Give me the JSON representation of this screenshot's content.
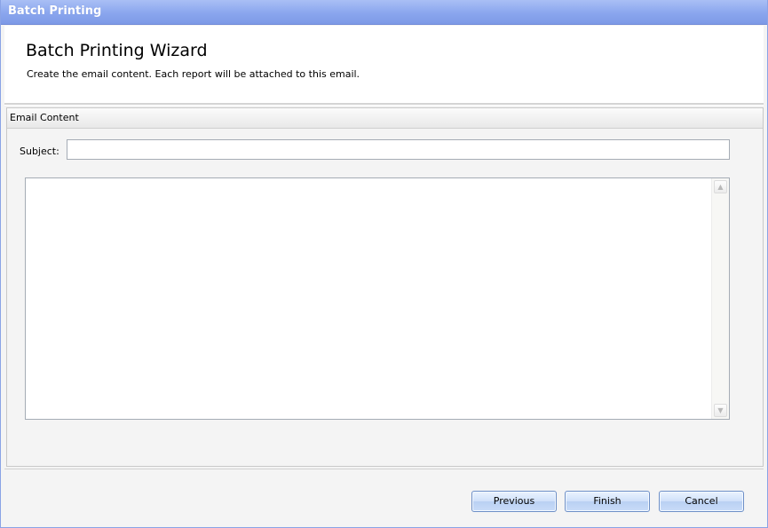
{
  "window": {
    "title": "Batch Printing"
  },
  "header": {
    "title": "Batch Printing Wizard",
    "subtitle": "Create the email content. Each report will be attached to this email."
  },
  "email_content": {
    "group_title": "Email Content",
    "subject_label": "Subject:",
    "subject_value": "",
    "body_value": ""
  },
  "scrollbar": {
    "up_icon": "▲",
    "down_icon": "▼"
  },
  "buttons": {
    "previous": "Previous",
    "finish": "Finish",
    "cancel": "Cancel"
  },
  "colors": {
    "titlebar": "#8aa6ee",
    "button_border": "#6d8fc7"
  }
}
